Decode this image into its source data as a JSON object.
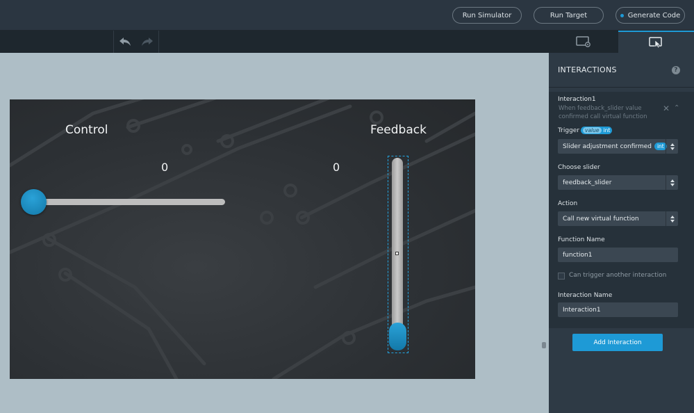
{
  "topbar": {
    "run_simulator": "Run Simulator",
    "run_target": "Run Target",
    "generate_code": "Generate Code"
  },
  "canvas": {
    "control_label": "Control",
    "feedback_label": "Feedback",
    "control_value": "0",
    "feedback_value": "0"
  },
  "panel": {
    "title": "INTERACTIONS",
    "help": "?",
    "interaction": {
      "name": "Interaction1",
      "description": "When feedback_slider value confirmed call virtual function",
      "trigger_label": "Trigger",
      "trigger_value_tag": "value",
      "trigger_type_tag": "int",
      "trigger_select": "Slider adjustment confirmed",
      "trigger_select_badge": "int",
      "choose_slider_label": "Choose slider",
      "choose_slider_value": "feedback_slider",
      "action_label": "Action",
      "action_value": "Call new virtual function",
      "function_name_label": "Function Name",
      "function_name_value": "function1",
      "chain_label": "Can trigger another interaction",
      "interaction_name_label": "Interaction Name",
      "interaction_name_value": "Interaction1"
    },
    "add_button": "Add Interaction"
  },
  "colors": {
    "accent": "#1e9ad6",
    "panel_bg": "#2e3a45",
    "canvas_bg": "#aebec6"
  }
}
